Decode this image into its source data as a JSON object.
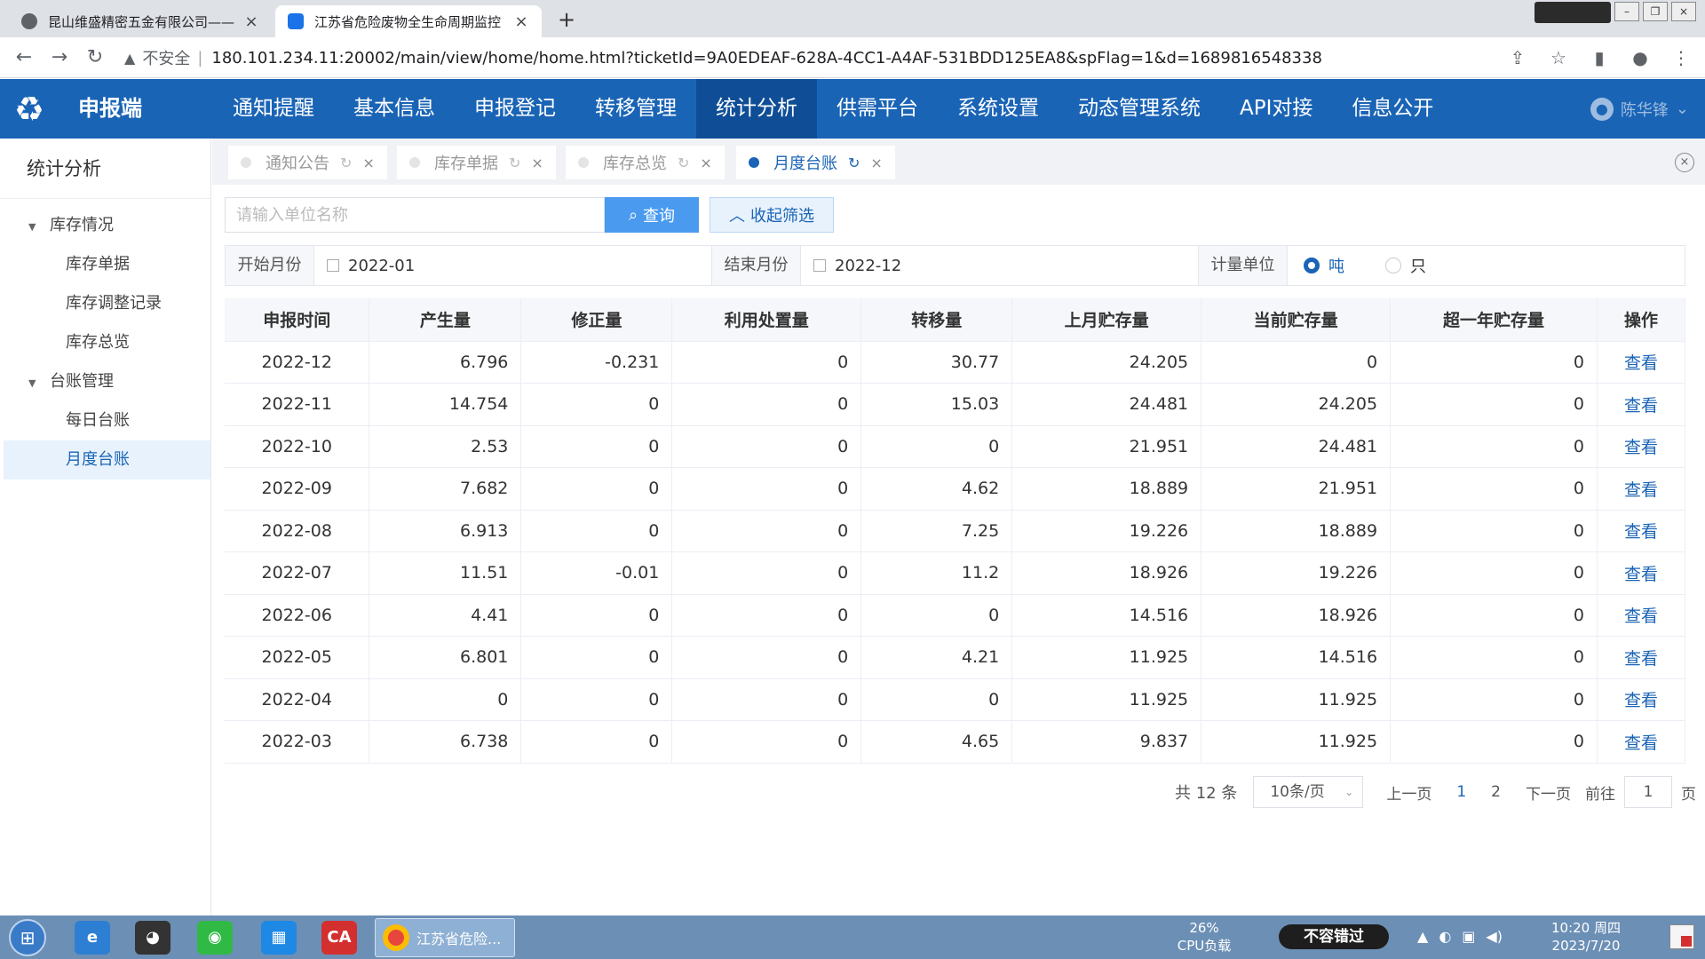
{
  "browser": {
    "tabs": [
      {
        "title": "昆山维盛精密五金有限公司——",
        "active": false
      },
      {
        "title": "江苏省危险废物全生命周期监控",
        "active": true
      }
    ],
    "new_tab": "+",
    "security_warning": "不安全",
    "url": "180.101.234.11:20002/main/view/home/home.html?ticketId=9A0EDEAF-628A-4CC1-A4AF-531BDD125EA8&spFlag=1&d=1689816548338"
  },
  "app": {
    "name": "申报端",
    "nav": [
      {
        "label": "通知提醒",
        "active": false
      },
      {
        "label": "基本信息",
        "active": false
      },
      {
        "label": "申报登记",
        "active": false
      },
      {
        "label": "转移管理",
        "active": false
      },
      {
        "label": "统计分析",
        "active": true
      },
      {
        "label": "供需平台",
        "active": false
      },
      {
        "label": "系统设置",
        "active": false
      },
      {
        "label": "动态管理系统",
        "active": false
      },
      {
        "label": "API对接",
        "active": false
      },
      {
        "label": "信息公开",
        "active": false
      }
    ],
    "user": "陈华锋",
    "accent_color": "#1a64b6"
  },
  "sidebar": {
    "title": "统计分析",
    "groups": [
      {
        "label": "库存情况",
        "items": [
          {
            "label": "库存单据",
            "active": false
          },
          {
            "label": "库存调整记录",
            "active": false
          },
          {
            "label": "库存总览",
            "active": false
          }
        ]
      },
      {
        "label": "台账管理",
        "items": [
          {
            "label": "每日台账",
            "active": false
          },
          {
            "label": "月度台账",
            "active": true
          }
        ]
      }
    ]
  },
  "page_tabs": [
    {
      "label": "通知公告",
      "active": false
    },
    {
      "label": "库存单据",
      "active": false
    },
    {
      "label": "库存总览",
      "active": false
    },
    {
      "label": "月度台账",
      "active": true
    }
  ],
  "search": {
    "placeholder": "请输入单位名称",
    "value": "",
    "query_label": "查询",
    "collapse_label": "收起筛选"
  },
  "filters": {
    "start_label": "开始月份",
    "start_value": "2022-01",
    "end_label": "结束月份",
    "end_value": "2022-12",
    "unit_label": "计量单位",
    "unit_options": [
      {
        "label": "吨",
        "selected": true
      },
      {
        "label": "只",
        "selected": false
      }
    ]
  },
  "table": {
    "columns": [
      "申报时间",
      "产生量",
      "修正量",
      "利用处置量",
      "转移量",
      "上月贮存量",
      "当前贮存量",
      "超一年贮存量",
      "操作"
    ],
    "rows": [
      [
        "2022-12",
        "6.796",
        "-0.231",
        "0",
        "30.77",
        "24.205",
        "0",
        "0",
        "查看"
      ],
      [
        "2022-11",
        "14.754",
        "0",
        "0",
        "15.03",
        "24.481",
        "24.205",
        "0",
        "查看"
      ],
      [
        "2022-10",
        "2.53",
        "0",
        "0",
        "0",
        "21.951",
        "24.481",
        "0",
        "查看"
      ],
      [
        "2022-09",
        "7.682",
        "0",
        "0",
        "4.62",
        "18.889",
        "21.951",
        "0",
        "查看"
      ],
      [
        "2022-08",
        "6.913",
        "0",
        "0",
        "7.25",
        "19.226",
        "18.889",
        "0",
        "查看"
      ],
      [
        "2022-07",
        "11.51",
        "-0.01",
        "0",
        "11.2",
        "18.926",
        "19.226",
        "0",
        "查看"
      ],
      [
        "2022-06",
        "4.41",
        "0",
        "0",
        "0",
        "14.516",
        "18.926",
        "0",
        "查看"
      ],
      [
        "2022-05",
        "6.801",
        "0",
        "0",
        "4.21",
        "11.925",
        "14.516",
        "0",
        "查看"
      ],
      [
        "2022-04",
        "0",
        "0",
        "0",
        "0",
        "11.925",
        "11.925",
        "0",
        "查看"
      ],
      [
        "2022-03",
        "6.738",
        "0",
        "0",
        "4.65",
        "9.837",
        "11.925",
        "0",
        "查看"
      ]
    ]
  },
  "pagination": {
    "total": "共 12 条",
    "page_size": "10条/页",
    "prev": "上一页",
    "pages": [
      "1",
      "2"
    ],
    "current_page": "1",
    "next": "下一页",
    "goto_label": "前往",
    "goto_value": "1",
    "page_suffix": "页"
  },
  "taskbar": {
    "running_app": "江苏省危险...",
    "cpu_percent": "26%",
    "cpu_label": "CPU负载",
    "promo": "不容错过",
    "time": "10:20 周四",
    "date": "2023/7/20"
  }
}
